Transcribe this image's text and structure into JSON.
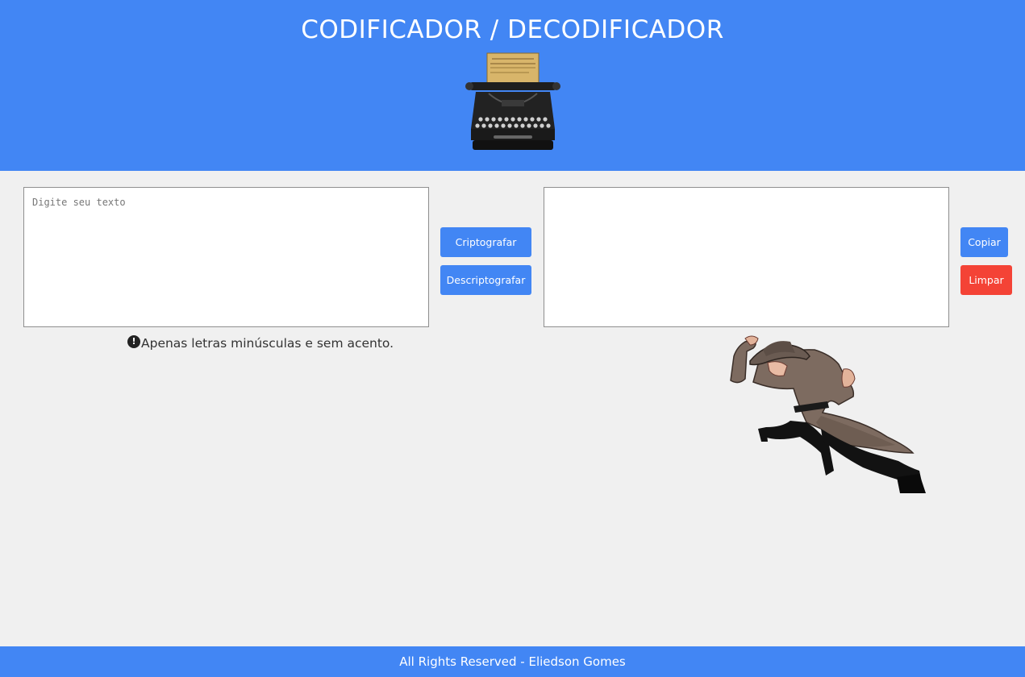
{
  "header": {
    "title": "CODIFICADOR / DECODIFICADOR",
    "logo_icon": "typewriter-icon"
  },
  "input": {
    "placeholder": "Digite seu texto",
    "value": ""
  },
  "actions": {
    "encrypt_label": "Criptografar",
    "decrypt_label": "Descriptografar",
    "copy_label": "Copiar",
    "clear_label": "Limpar"
  },
  "output": {
    "value": ""
  },
  "hint": {
    "icon": "exclamation-circle-icon",
    "icon_glyph": "!",
    "text": "Apenas letras minúsculas e sem acento."
  },
  "illustration": {
    "icon": "running-detective-illustration"
  },
  "footer": {
    "text": "All Rights Reserved - Eliedson Gomes"
  },
  "colors": {
    "primary": "#4286f4",
    "danger": "#f44336",
    "background": "#f0f0f0"
  }
}
